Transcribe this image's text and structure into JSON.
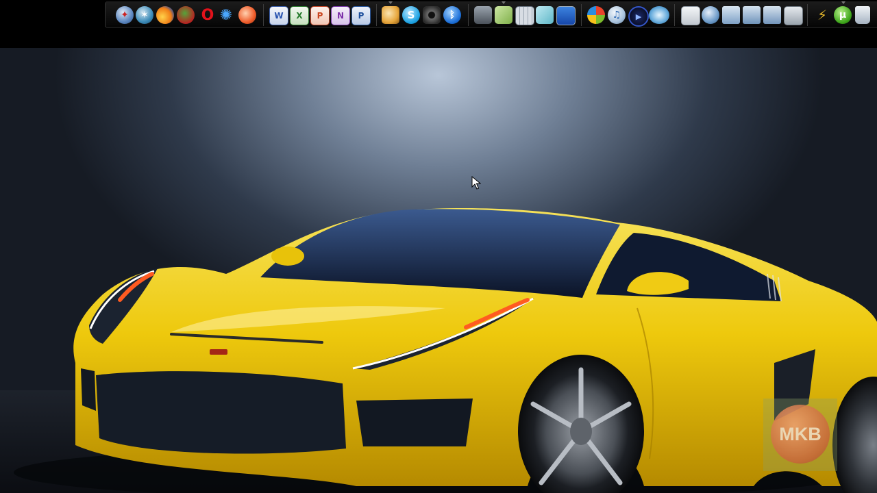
{
  "dock": {
    "groups": [
      {
        "name": "browsers",
        "icons": [
          "safari-icon",
          "navigator-icon",
          "firefox-icon",
          "flock-icon",
          "opera-icon",
          "sunbird-icon",
          "thunderbird-icon"
        ]
      },
      {
        "name": "office",
        "icons": [
          "word-icon",
          "excel-icon",
          "powerpoint-icon",
          "onenote-icon",
          "publisher-icon"
        ]
      },
      {
        "name": "communication",
        "icons": [
          "mail-icon",
          "skype-icon",
          "webcam-icon",
          "bluetooth-icon"
        ]
      },
      {
        "name": "utilities",
        "icons": [
          "camera-icon",
          "paint-icon",
          "calculator-icon",
          "notes-icon",
          "remote-desktop-icon"
        ]
      },
      {
        "name": "media",
        "icons": [
          "windows-media-icon",
          "itunes-icon",
          "media-player-icon",
          "dvd-icon"
        ]
      },
      {
        "name": "system",
        "icons": [
          "documents-icon",
          "network-icon",
          "folder-icon",
          "folder-open-icon",
          "folder-stack-icon",
          "settings-icon"
        ]
      },
      {
        "name": "tools",
        "icons": [
          "run-icon",
          "utorrent-icon",
          "recycle-bin-icon"
        ]
      }
    ]
  },
  "wallpaper": {
    "subject": "yellow sports car",
    "watermark_text": "MKB"
  },
  "colors": {
    "car_yellow": "#f2c80c",
    "background_blue": "#4a5a72",
    "watermark_orange": "#c8663a"
  }
}
